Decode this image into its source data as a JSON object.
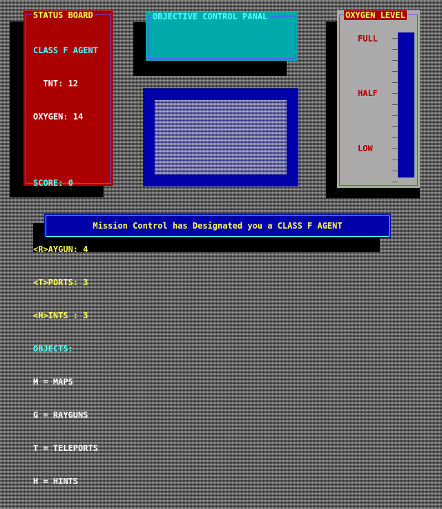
{
  "status_board": {
    "title": "STATUS BOARD",
    "agent_class": "CLASS F AGENT",
    "tnt": "  TNT: 12",
    "oxygen": "OXYGEN: 14",
    "score": "SCORE: 0",
    "raygun": "<R>AYGUN: 4",
    "teleports": "<T>PORTS: 3",
    "hints": "<H>INTS : 3",
    "objects_header": "OBJECTS:",
    "legend": [
      "M = MAPS",
      "G = RAYGUNS",
      "T = TELEPORTS",
      "H = HINTS"
    ]
  },
  "objective_panel": {
    "title": "OBJECTIVE CONTROL PANAL"
  },
  "oxygen_level": {
    "title": "OXYGEN LEVEL",
    "full_label": "FULL",
    "half_label": "HALF",
    "low_label": "LOW",
    "level": 1.0
  },
  "message": {
    "text": "Mission Control has Designated you a CLASS F AGENT"
  },
  "colors": {
    "red_panel": "#aa0000",
    "cyan_panel": "#00aaaa",
    "blue": "#0000aa",
    "yellow": "#ffff55",
    "cyan_text": "#55ffff"
  }
}
